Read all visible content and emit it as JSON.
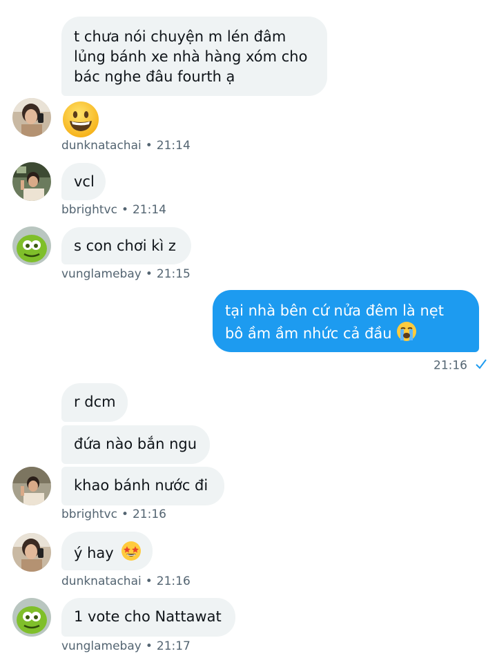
{
  "messages": {
    "m1": {
      "text_line1": "t chưa nói chuyện m lén đâm",
      "text_line2": "lủng bánh xe nhà hàng xóm cho",
      "text_line3": "bác nghe đâu fourth ạ"
    },
    "m2": {
      "emoji": "grinning-face-emoji",
      "sender": "dunknatachai",
      "time": "21:14"
    },
    "m3": {
      "text": "vcl",
      "sender": "bbrightvc",
      "time": "21:14"
    },
    "m4": {
      "text": "s con chơi kì z",
      "sender": "vunglamebay",
      "time": "21:15"
    },
    "m5": {
      "text_line1": "tại nhà bên cứ nửa đêm là nẹt",
      "text_line2": "bô ầm ầm nhức cả đầu",
      "emoji": "loudly-crying-face-emoji",
      "time": "21:16"
    },
    "m6": {
      "text": "r dcm"
    },
    "m7": {
      "text": "đứa nào bắn ngu"
    },
    "m8": {
      "text": "khao bánh nước đi",
      "sender": "bbrightvc",
      "time": "21:16"
    },
    "m9": {
      "text": "ý hay",
      "emoji": "star-struck-emoji",
      "sender": "dunknatachai",
      "time": "21:16"
    },
    "m10": {
      "text": "1 vote cho Nattawat",
      "sender": "vunglamebay",
      "time": "21:17"
    }
  },
  "separator": "•",
  "colors": {
    "incoming_bubble": "#eff3f4",
    "outgoing_bubble": "#1d9bf0",
    "meta_text": "#536471",
    "read_check": "#1d9bf0"
  }
}
